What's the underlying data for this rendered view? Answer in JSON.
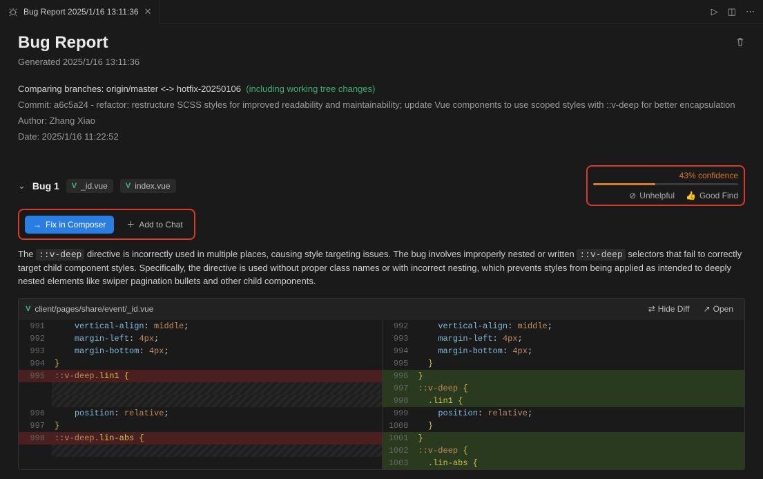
{
  "tab": {
    "title": "Bug Report 2025/1/16 13:11:36"
  },
  "header": {
    "title": "Bug Report",
    "generated_prefix": "Generated ",
    "generated": "2025/1/16 13:11:36"
  },
  "compare": {
    "label": "Comparing branches: origin/master <-> hotfix-20250106",
    "note": "(including working tree changes)"
  },
  "commit": {
    "line": "Commit: a6c5a24 - refactor: restructure SCSS styles for improved readability and maintainability; update Vue components to use scoped styles with ::v-deep for better encapsulation",
    "author": "Author: Zhang Xiao",
    "date": "Date: 2025/1/16 11:22:52"
  },
  "bug": {
    "title": "Bug 1",
    "files": [
      "_id.vue",
      "index.vue"
    ],
    "confidence_label": "43% confidence",
    "confidence_pct": 43,
    "actions": {
      "fix": "Fix in Composer",
      "add_chat": "Add to Chat",
      "unhelpful": "Unhelpful",
      "good_find": "Good Find"
    },
    "description_parts": {
      "p1": "The ",
      "c1": "::v-deep",
      "p2": " directive is incorrectly used in multiple places, causing style targeting issues. The bug involves improperly nested or written ",
      "c2": "::v-deep",
      "p3": " selectors that fail to correctly target child component styles. Specifically, the directive is used without proper class names or with incorrect nesting, which prevents styles from being applied as intended to deeply nested elements like swiper pagination bullets and other child components."
    }
  },
  "diff": {
    "filepath": "client/pages/share/event/_id.vue",
    "hide_diff": "Hide Diff",
    "open": "Open",
    "left": [
      {
        "n": 991,
        "t": "ctx",
        "c": "    vertical-align: middle;"
      },
      {
        "n": 992,
        "t": "ctx",
        "c": "    margin-left: 4px;"
      },
      {
        "n": 993,
        "t": "ctx",
        "c": "    margin-bottom: 4px;"
      },
      {
        "n": 994,
        "t": "ctx",
        "c": "}"
      },
      {
        "n": 995,
        "t": "del",
        "c": "::v-deep.lin1 {"
      },
      {
        "n": "",
        "t": "hatch",
        "c": ""
      },
      {
        "n": "",
        "t": "hatch",
        "c": ""
      },
      {
        "n": 996,
        "t": "ctx",
        "c": "    position: relative;"
      },
      {
        "n": 997,
        "t": "ctx",
        "c": "}"
      },
      {
        "n": 998,
        "t": "del",
        "c": "::v-deep.lin-abs {"
      },
      {
        "n": "",
        "t": "hatch",
        "c": ""
      }
    ],
    "right": [
      {
        "n": 992,
        "t": "ctx",
        "c": "    vertical-align: middle;"
      },
      {
        "n": 993,
        "t": "ctx",
        "c": "    margin-left: 4px;"
      },
      {
        "n": 994,
        "t": "ctx",
        "c": "    margin-bottom: 4px;"
      },
      {
        "n": 995,
        "t": "ctx",
        "c": "  }"
      },
      {
        "n": 996,
        "t": "add",
        "c": "}"
      },
      {
        "n": 997,
        "t": "add",
        "c": "::v-deep {"
      },
      {
        "n": 998,
        "t": "add",
        "c": "  .lin1 {"
      },
      {
        "n": 999,
        "t": "ctx",
        "c": "    position: relative;"
      },
      {
        "n": 1000,
        "t": "ctx",
        "c": "  }"
      },
      {
        "n": 1001,
        "t": "add",
        "c": "}"
      },
      {
        "n": 1002,
        "t": "add",
        "c": "::v-deep {"
      },
      {
        "n": 1003,
        "t": "add",
        "c": "  .lin-abs {"
      }
    ]
  }
}
